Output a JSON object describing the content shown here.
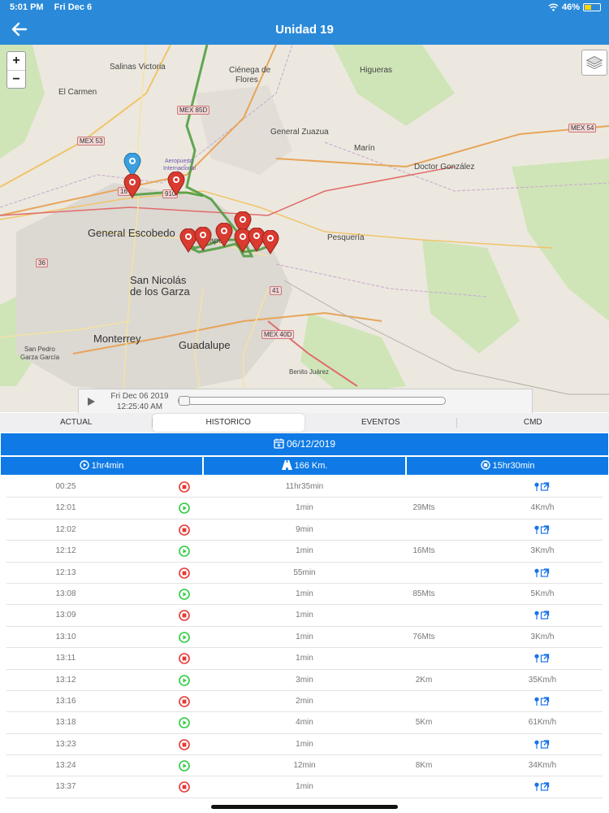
{
  "status_bar": {
    "time": "5:01 PM",
    "date": "Fri Dec 6",
    "battery": "46%",
    "battery_level": 0.46
  },
  "header": {
    "title": "Unidad 19",
    "back_icon": "arrow-left-icon"
  },
  "map": {
    "zoom_in": "+",
    "zoom_out": "−",
    "labels": {
      "salinas_victoria": "Salinas Victoria",
      "cienega": "Ciénega de",
      "flores": "Flores",
      "higueras": "Higueras",
      "el_carmen": "El Carmen",
      "general_zuazua": "General Zuazua",
      "marin": "Marín",
      "doctor_gonzalez": "Doctor González",
      "general_escobedo": "General Escobedo",
      "pesqueria": "Pesquería",
      "san_nicolas": "San Nicolás",
      "de_los_garza": "de los Garza",
      "monterrey": "Monterrey",
      "guadalupe": "Guadalupe",
      "san_pedro": "San Pedro",
      "garza_garcia": "Garza García",
      "benito_juarez": "Benito Juárez",
      "aeropuerto": "Aeropuerto",
      "internacional": "Internacional",
      "mex85d": "MEX 85D",
      "mex53": "MEX 53",
      "mex54": "MEX 54",
      "mex40d": "MEX 40D",
      "r16": "16",
      "r36": "36",
      "r41": "41",
      "r910": "910",
      "apo": "apo"
    }
  },
  "playback": {
    "date": "Fri Dec 06 2019",
    "time": "12:25:40 AM",
    "progress": 0
  },
  "tabs": [
    {
      "label": "ACTUAL",
      "active": false
    },
    {
      "label": "HISTORICO",
      "active": true
    },
    {
      "label": "EVENTOS",
      "active": false
    },
    {
      "label": "CMD",
      "active": false
    }
  ],
  "summary": {
    "date": "06/12/2019",
    "moving_time": "1hr4min",
    "distance": "166 Km.",
    "stopped_time": "15hr30min"
  },
  "colors": {
    "header": "#2a8ad9",
    "bar": "#0f7ae5",
    "stop": "#e53935",
    "move": "#2ecc40",
    "link": "#1a73e8"
  },
  "rows": [
    {
      "time": "00:25",
      "type": "stop",
      "duration": "11hr35min",
      "distance": "",
      "speed": ""
    },
    {
      "time": "12:01",
      "type": "move",
      "duration": "1min",
      "distance": "29Mts",
      "speed": "4Km/h"
    },
    {
      "time": "12:02",
      "type": "stop",
      "duration": "9min",
      "distance": "",
      "speed": ""
    },
    {
      "time": "12:12",
      "type": "move",
      "duration": "1min",
      "distance": "16Mts",
      "speed": "3Km/h"
    },
    {
      "time": "12:13",
      "type": "stop",
      "duration": "55min",
      "distance": "",
      "speed": ""
    },
    {
      "time": "13:08",
      "type": "move",
      "duration": "1min",
      "distance": "85Mts",
      "speed": "5Km/h"
    },
    {
      "time": "13:09",
      "type": "stop",
      "duration": "1min",
      "distance": "",
      "speed": ""
    },
    {
      "time": "13:10",
      "type": "move",
      "duration": "1min",
      "distance": "76Mts",
      "speed": "3Km/h"
    },
    {
      "time": "13:11",
      "type": "stop",
      "duration": "1min",
      "distance": "",
      "speed": ""
    },
    {
      "time": "13:12",
      "type": "move",
      "duration": "3min",
      "distance": "2Km",
      "speed": "35Km/h"
    },
    {
      "time": "13:16",
      "type": "stop",
      "duration": "2min",
      "distance": "",
      "speed": ""
    },
    {
      "time": "13:18",
      "type": "move",
      "duration": "4min",
      "distance": "5Km",
      "speed": "61Km/h"
    },
    {
      "time": "13:23",
      "type": "stop",
      "duration": "1min",
      "distance": "",
      "speed": ""
    },
    {
      "time": "13:24",
      "type": "move",
      "duration": "12min",
      "distance": "8Km",
      "speed": "34Km/h"
    },
    {
      "time": "13:37",
      "type": "stop",
      "duration": "1min",
      "distance": "",
      "speed": ""
    }
  ]
}
